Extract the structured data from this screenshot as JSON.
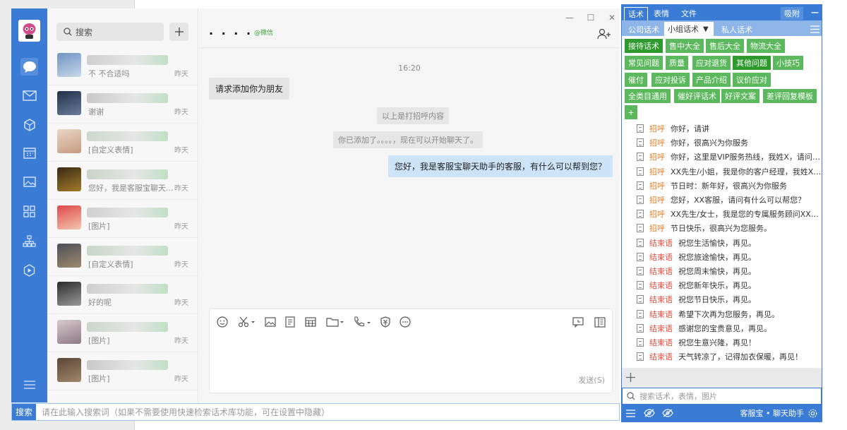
{
  "colors": {
    "accent": "#3a7bd5",
    "tag_green": "#5cb85c",
    "tag_dark_green": "#2e9a2e",
    "bubble_out": "#cde3f7",
    "greeting_cat": "#e67e22",
    "closing_cat": "#e74c3c"
  },
  "contacts": {
    "search_placeholder": "搜索",
    "items": [
      {
        "preview": "不   不合适吗",
        "time": "昨天"
      },
      {
        "preview": "谢谢",
        "time": "昨天"
      },
      {
        "preview": "[自定义表情]",
        "time": "昨天"
      },
      {
        "preview": "您好，我是客服宝聊天...",
        "time": "昨天"
      },
      {
        "preview": "[图片]",
        "time": "昨天"
      },
      {
        "preview": "[自定义表情]",
        "time": "昨天"
      },
      {
        "preview": "好的呢",
        "time": "昨天"
      },
      {
        "preview": "[图片]",
        "time": "昨天"
      },
      {
        "preview": "[图片]",
        "time": "昨天"
      }
    ]
  },
  "chat": {
    "title": ". . . .",
    "source_tag": "@微信",
    "time": "16:20",
    "incoming": "请求添加你为朋友",
    "sys1": "以上是打招呼内容",
    "sys2": "你已添加了。。。。，现在可以开始聊天了。",
    "outgoing": "您好，我是客服宝聊天助手的客服，有什么可以帮到您？",
    "send_label": "发送(S)"
  },
  "bottom_bar": {
    "label": "搜索",
    "placeholder": "请在此输入搜索词（如果不需要使用快速检索话术库功能，可在设置中隐藏）"
  },
  "right_panel": {
    "tabs": [
      "话术",
      "表情",
      "文件"
    ],
    "pin_label": "吸附",
    "sub_tabs": [
      "公司话术",
      "小组话术",
      "私人话术"
    ],
    "tags": [
      "接待话术",
      "售中大全",
      "售后大全",
      "物流大全",
      "常见问题",
      "质量",
      "应对退货",
      "其他问题",
      "小技巧",
      "催付",
      "应对投诉",
      "产品介绍",
      "议价应对",
      "全类目通用",
      "催好评话术",
      "好评文案",
      "差评回复模板"
    ],
    "add_tag": "+",
    "scripts": [
      {
        "cat": "招呼",
        "text": "你好，请讲"
      },
      {
        "cat": "招呼",
        "text": "你好，很高兴为你服务"
      },
      {
        "cat": "招呼",
        "text": "你好，这里是VIP服务热线，我姓X，请问有什..."
      },
      {
        "cat": "招呼",
        "text": "XX先生/小姐，我是你的客户经理，我姓X，很..."
      },
      {
        "cat": "招呼",
        "text": "节日时：新年好，很高兴为你服务"
      },
      {
        "cat": "招呼",
        "text": "您好，XX客服，请问有什么可以帮您？"
      },
      {
        "cat": "招呼",
        "text": "XX先生/女士，我是您的专属服务顾问XX，很..."
      },
      {
        "cat": "招呼",
        "text": "节日快乐，很高兴为您服务。"
      },
      {
        "cat": "结束语",
        "text": "祝您生活愉快，再见。"
      },
      {
        "cat": "结束语",
        "text": "祝您旅途愉快，再见。"
      },
      {
        "cat": "结束语",
        "text": "祝您周末愉快，再见。"
      },
      {
        "cat": "结束语",
        "text": "祝您新年快乐，再见。"
      },
      {
        "cat": "结束语",
        "text": "祝您节日快乐，再见。"
      },
      {
        "cat": "结束语",
        "text": "希望下次再为您服务，再见。"
      },
      {
        "cat": "结束语",
        "text": "感谢您的宝贵意见，再见。"
      },
      {
        "cat": "结束语",
        "text": "祝您生意兴隆，再见！"
      },
      {
        "cat": "结束语",
        "text": "天气转凉了，记得加衣保暖，再见！"
      }
    ],
    "search_placeholder": "搜索话术，表情，图片",
    "footer_brand": "客服宝 • 聊天助手"
  }
}
